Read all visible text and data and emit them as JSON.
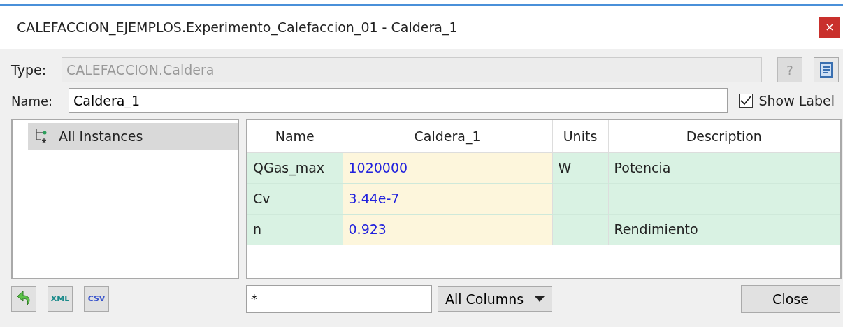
{
  "window": {
    "title": "CALEFACCION_EJEMPLOS.Experimento_Calefaccion_01 - Caldera_1",
    "close": "×"
  },
  "type_field": {
    "label": "Type:",
    "value": "CALEFACCION.Caldera",
    "disabled": true
  },
  "help_button": {
    "label": "?",
    "disabled": true
  },
  "name_field": {
    "label": "Name:",
    "value": "Caldera_1"
  },
  "show_label": {
    "label": "Show Label",
    "checked": true
  },
  "tree": {
    "items": [
      {
        "label": "All Instances",
        "selected": true
      }
    ]
  },
  "table": {
    "columns": [
      "Name",
      "Caldera_1",
      "Units",
      "Description"
    ],
    "rows": [
      {
        "name": "QGas_max",
        "value": "1020000",
        "units": "W",
        "description": "Potencia"
      },
      {
        "name": "Cv",
        "value": "3.44e-7",
        "units": "",
        "description": ""
      },
      {
        "name": "n",
        "value": "0.923",
        "units": "",
        "description": "Rendimiento"
      }
    ]
  },
  "export_buttons": [
    {
      "kind": "undo"
    },
    {
      "kind": "text",
      "label": "XML"
    },
    {
      "kind": "text",
      "label": "CSV"
    }
  ],
  "filter": {
    "value": "*"
  },
  "column_select": {
    "value": "All Columns"
  },
  "close_button": {
    "label": "Close"
  }
}
